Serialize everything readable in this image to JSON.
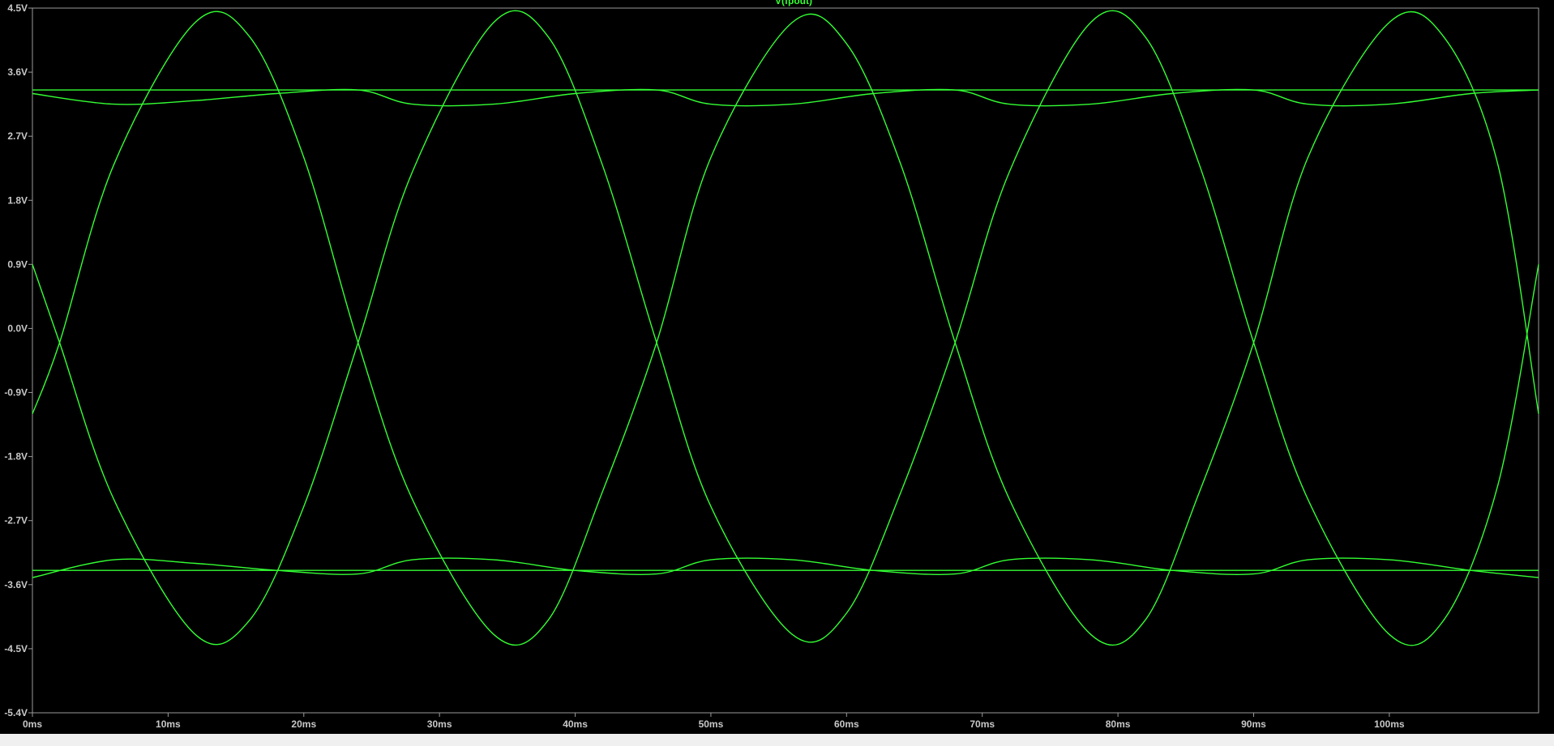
{
  "trace": {
    "label": "V(fpout)",
    "color": "#33ff33"
  },
  "colors": {
    "background": "#000000",
    "frame": "#9a9a9a",
    "tick_text": "#c8c8c8",
    "status_strip": "#f0f0f0"
  },
  "chart_data": {
    "type": "line",
    "title": "V(fpout)",
    "xlabel": "",
    "ylabel": "",
    "xlim_ms": [
      0,
      111
    ],
    "ylim_v": [
      -5.4,
      4.5
    ],
    "grid": false,
    "x_ticks": [
      "0ms",
      "10ms",
      "20ms",
      "30ms",
      "40ms",
      "50ms",
      "60ms",
      "70ms",
      "80ms",
      "90ms",
      "100ms"
    ],
    "y_ticks": [
      "4.5V",
      "3.6V",
      "2.7V",
      "1.8V",
      "0.9V",
      "0.0V",
      "-0.9V",
      "-1.8V",
      "-2.7V",
      "-3.6V",
      "-4.5V",
      "-5.4V"
    ],
    "series": [
      {
        "name": "V(fpout)",
        "description_of_shape": "overlapping sine-like traces, period ~44ms, crossing ~-0.2V near 2, 24, 46, 68, 90ms",
        "x_ms": [
          0,
          2,
          6,
          12,
          16,
          20,
          24,
          28,
          34,
          38,
          42,
          46,
          50,
          56,
          60,
          64,
          68,
          72,
          78,
          82,
          86,
          90,
          94,
          100,
          104,
          108,
          111
        ],
        "y_v": [
          0.9,
          -0.2,
          -2.4,
          -4.3,
          -4.1,
          -2.5,
          -0.2,
          2.2,
          4.3,
          4.1,
          2.3,
          -0.2,
          -2.5,
          -4.3,
          -4.0,
          -2.3,
          -0.2,
          2.2,
          4.3,
          4.1,
          2.3,
          -0.2,
          -2.4,
          -4.3,
          -4.1,
          -2.2,
          0.9
        ]
      },
      {
        "name": "V(fpout)",
        "x_ms": [
          0,
          2,
          6,
          12,
          16,
          20,
          24,
          28,
          34,
          38,
          42,
          46,
          50,
          56,
          60,
          64,
          68,
          72,
          78,
          82,
          86,
          90,
          94,
          100,
          104,
          108,
          111
        ],
        "y_v": [
          -1.2,
          -0.2,
          2.3,
          4.3,
          4.1,
          2.4,
          -0.2,
          -2.4,
          -4.3,
          -4.1,
          -2.3,
          -0.2,
          2.4,
          4.3,
          4.0,
          2.3,
          -0.2,
          -2.4,
          -4.3,
          -4.1,
          -2.3,
          -0.2,
          2.4,
          4.3,
          4.1,
          2.3,
          -1.2
        ]
      },
      {
        "name": "V(fpout)",
        "x_ms": [
          0,
          6,
          12,
          18,
          24,
          28,
          34,
          40,
          46,
          50,
          56,
          62,
          68,
          72,
          78,
          84,
          90,
          94,
          100,
          106,
          111
        ],
        "y_v": [
          3.3,
          3.15,
          3.2,
          3.3,
          3.35,
          3.15,
          3.15,
          3.3,
          3.35,
          3.15,
          3.15,
          3.3,
          3.35,
          3.15,
          3.15,
          3.3,
          3.35,
          3.15,
          3.15,
          3.3,
          3.35
        ]
      },
      {
        "name": "V(fpout)",
        "x_ms": [
          0,
          6,
          12,
          18,
          24,
          28,
          34,
          40,
          46,
          50,
          56,
          62,
          68,
          72,
          78,
          84,
          90,
          94,
          100,
          106,
          111
        ],
        "y_v": [
          -3.5,
          -3.25,
          -3.3,
          -3.4,
          -3.45,
          -3.25,
          -3.25,
          -3.4,
          -3.45,
          -3.25,
          -3.25,
          -3.4,
          -3.45,
          -3.25,
          -3.25,
          -3.4,
          -3.45,
          -3.25,
          -3.25,
          -3.4,
          -3.5
        ]
      },
      {
        "name": "V(fpout)",
        "x_ms": [
          0,
          111
        ],
        "y_v": [
          3.35,
          3.35
        ]
      },
      {
        "name": "V(fpout)",
        "x_ms": [
          0,
          111
        ],
        "y_v": [
          -3.4,
          -3.4
        ]
      }
    ]
  }
}
